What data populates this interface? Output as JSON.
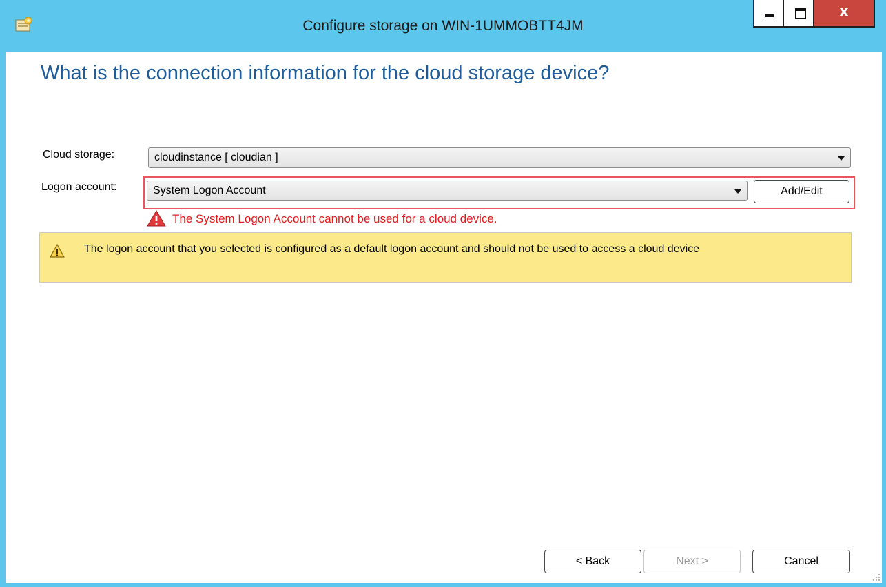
{
  "window": {
    "title": "Configure storage on WIN-1UMMOBTT4JM",
    "close_glyph": "x"
  },
  "page": {
    "heading": "What is the connection information for the cloud storage device?"
  },
  "form": {
    "cloud_storage": {
      "label": "Cloud storage:",
      "value": "cloudinstance  [ cloudian ]"
    },
    "logon_account": {
      "label": "Logon account:",
      "value": "System Logon Account",
      "add_edit_label": "Add/Edit"
    },
    "error": {
      "message": "The System Logon Account cannot be used for a cloud device.",
      "color": "#e31b1b"
    }
  },
  "warning": {
    "message": "The logon account that you selected is configured as a default logon account and should not be used to access a cloud device",
    "background": "#fbe98a"
  },
  "footer": {
    "back_label": "< Back",
    "next_label": "Next >",
    "cancel_label": "Cancel"
  },
  "colors": {
    "titlebar": "#5cc6ec",
    "heading": "#1e5c9a",
    "close_button": "#c9463f"
  }
}
